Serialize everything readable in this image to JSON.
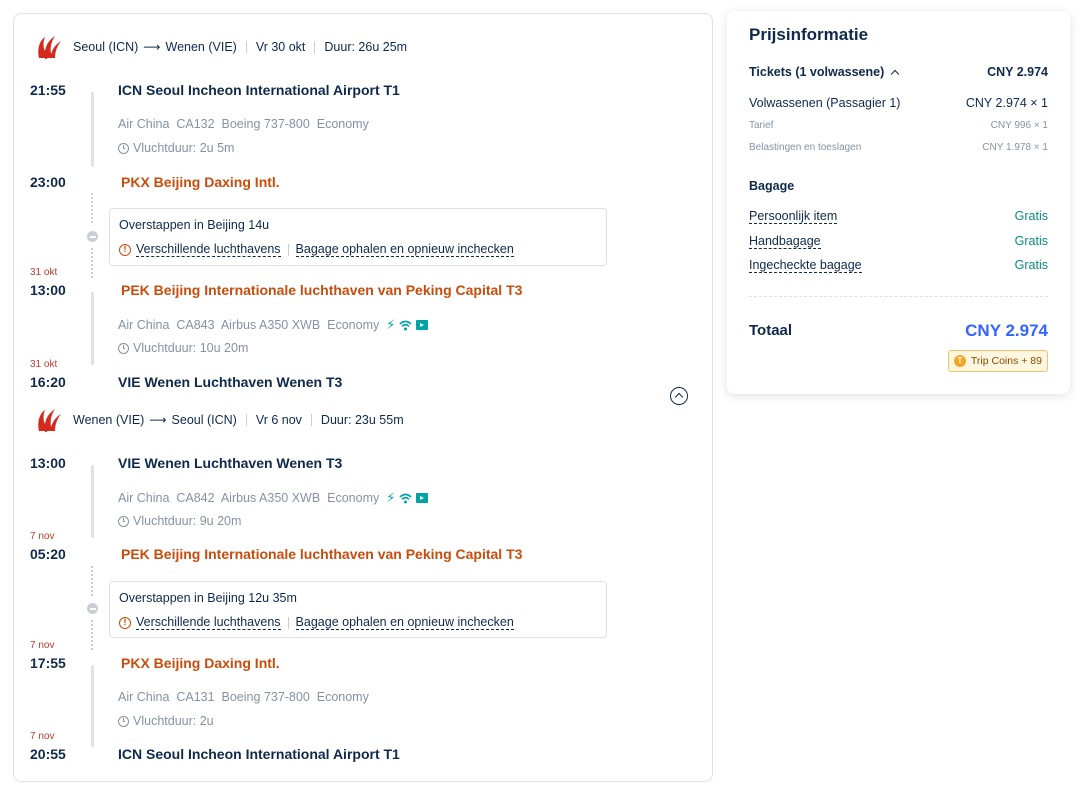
{
  "outbound": {
    "header": {
      "from": "Seoul (ICN)",
      "to": "Wenen (VIE)",
      "date": "Vr 30 okt",
      "duration": "Duur: 26u 25m"
    },
    "seg1": {
      "dep_time": "21:55",
      "dep_airport": "ICN Seoul Incheon International Airport T1",
      "info": "Air China  CA132  Boeing 737-800  Economy",
      "duration": "Vluchtduur: 2u 5m",
      "arr_time": "23:00",
      "arr_airport": "PKX Beijing Daxing Intl."
    },
    "layover": {
      "title": "Overstappen in Beijing  14u",
      "warn1": "Verschillende luchthavens",
      "warn2": "Bagage ophalen en opnieuw inchecken"
    },
    "seg2": {
      "dep_date": "31 okt",
      "dep_time": "13:00",
      "dep_airport": "PEK Beijing Internationale luchthaven van Peking Capital T3",
      "info": "Air China  CA843  Airbus A350 XWB  Economy",
      "duration": "Vluchtduur: 10u 20m",
      "arr_date": "31 okt",
      "arr_time": "16:20",
      "arr_airport": "VIE Wenen Luchthaven Wenen T3"
    }
  },
  "return": {
    "header": {
      "from": "Wenen (VIE)",
      "to": "Seoul (ICN)",
      "date": "Vr 6 nov",
      "duration": "Duur: 23u 55m"
    },
    "seg1": {
      "dep_time": "13:00",
      "dep_airport": "VIE Wenen Luchthaven Wenen T3",
      "info": "Air China  CA842  Airbus A350 XWB  Economy",
      "duration": "Vluchtduur: 9u 20m",
      "arr_date": "7 nov",
      "arr_time": "05:20",
      "arr_airport": "PEK Beijing Internationale luchthaven van Peking Capital T3"
    },
    "layover": {
      "title": "Overstappen in Beijing  12u 35m",
      "warn1": "Verschillende luchthavens",
      "warn2": "Bagage ophalen en opnieuw inchecken"
    },
    "seg2": {
      "dep_date": "7 nov",
      "dep_time": "17:55",
      "dep_airport": "PKX Beijing Daxing Intl.",
      "info": "Air China  CA131  Boeing 737-800  Economy",
      "duration": "Vluchtduur: 2u",
      "arr_date": "7 nov",
      "arr_time": "20:55",
      "arr_airport": "ICN Seoul Incheon International Airport T1"
    }
  },
  "price": {
    "title": "Prijsinformatie",
    "tickets_label": "Tickets (1 volwassene)",
    "tickets_total": "CNY 2.974",
    "adult_label": "Volwassenen (Passagier 1)",
    "adult_value": "CNY 2.974 × 1",
    "fare_label": "Tarief",
    "fare_value": "CNY 996 × 1",
    "tax_label": "Belastingen en toeslagen",
    "tax_value": "CNY 1.978 × 1",
    "baggage_title": "Bagage",
    "baggage": [
      {
        "label": "Persoonlijk item",
        "value": "Gratis"
      },
      {
        "label": "Handbagage",
        "value": "Gratis"
      },
      {
        "label": "Ingecheckte bagage",
        "value": "Gratis"
      }
    ],
    "total_label": "Totaal",
    "total_value": "CNY 2.974",
    "coins": "Trip Coins + 89"
  },
  "colors": {
    "primary_text": "#0f294d",
    "orange_airport": "#c94c0c",
    "total_blue": "#3264ff",
    "free_green": "#0e8a7e",
    "amenity_teal": "#00a2a6"
  },
  "icons": {
    "airline_logo": "air-china-logo",
    "amenities": [
      "power-icon",
      "wifi-icon",
      "entertainment-icon"
    ]
  }
}
